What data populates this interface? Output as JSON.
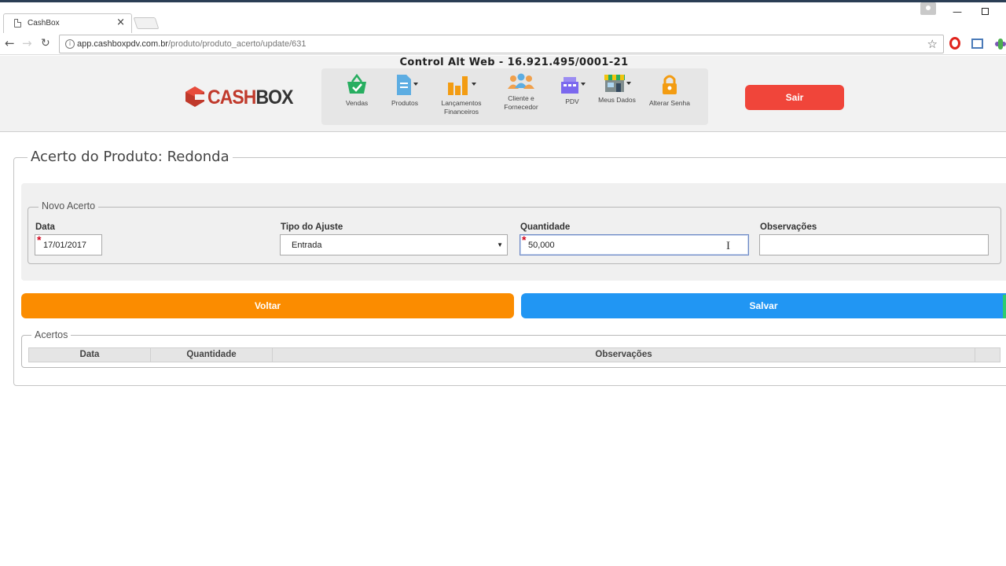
{
  "browser": {
    "tab_title": "CashBox",
    "tab_close": "×",
    "url_host": "app.cashboxpdv.com.br",
    "url_path": "/produto/produto_acerto/update/631",
    "win_min": "—"
  },
  "header": {
    "company": "Control Alt Web - 16.921.495/0001-21",
    "logo_cash": "CASH",
    "logo_box": "BOX",
    "menu": [
      {
        "label": "Vendas",
        "icon": "basket-icon"
      },
      {
        "label": "Produtos",
        "icon": "document-icon"
      },
      {
        "label": "Lançamentos Financeiros",
        "icon": "bar-chart-icon"
      },
      {
        "label": "Cliente e Fornecedor",
        "icon": "people-icon"
      },
      {
        "label": "PDV",
        "icon": "cash-register-icon"
      },
      {
        "label": "Meus Dados",
        "icon": "store-icon"
      },
      {
        "label": "Alterar Senha",
        "icon": "padlock-icon"
      }
    ],
    "logout_label": "Sair"
  },
  "page": {
    "title": "Acerto do Produto: Redonda",
    "novo_legend": "Novo Acerto",
    "fields": {
      "data_label": "Data",
      "data_value": "17/01/2017",
      "tipo_label": "Tipo do Ajuste",
      "tipo_value": "Entrada",
      "quantidade_label": "Quantidade",
      "quantidade_value": "50,000",
      "obs_label": "Observações",
      "obs_value": "",
      "required_mark": "*"
    },
    "voltar_label": "Voltar",
    "salvar_label": "Salvar",
    "acertos": {
      "legend": "Acertos",
      "columns": [
        "Data",
        "Quantidade",
        "Observações"
      ]
    }
  },
  "colors": {
    "sair": "#f0453a",
    "voltar": "#fb8c00",
    "salvar": "#2196f3"
  }
}
